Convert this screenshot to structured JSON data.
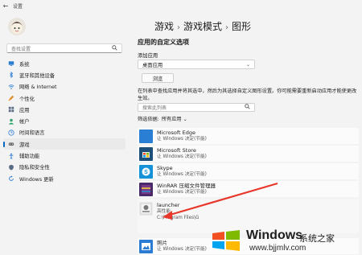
{
  "window": {
    "title": "设置",
    "back_glyph": "←"
  },
  "sidebar": {
    "search_placeholder": "查找设置",
    "items": [
      {
        "label": "系统",
        "icon": "display-icon",
        "color": "#2b7cd3"
      },
      {
        "label": "蓝牙和其他设备",
        "icon": "bluetooth-icon",
        "color": "#2b7cd3"
      },
      {
        "label": "网络 & Internet",
        "icon": "wifi-icon",
        "color": "#2b7cd3"
      },
      {
        "label": "个性化",
        "icon": "brush-icon",
        "color": "#e08a2a"
      },
      {
        "label": "应用",
        "icon": "apps-icon",
        "color": "#5a6b86"
      },
      {
        "label": "帐户",
        "icon": "account-icon",
        "color": "#2fa36b"
      },
      {
        "label": "时间和语言",
        "icon": "clock-globe-icon",
        "color": "#2b7cd3"
      },
      {
        "label": "游戏",
        "icon": "gamepad-icon",
        "color": "#6b6b6b",
        "active": true
      },
      {
        "label": "辅助功能",
        "icon": "accessibility-icon",
        "color": "#2b7cd3"
      },
      {
        "label": "隐私和安全性",
        "icon": "shield-icon",
        "color": "#5a6b86"
      },
      {
        "label": "Windows 更新",
        "icon": "update-icon",
        "color": "#2b7cd3"
      }
    ]
  },
  "breadcrumb": {
    "part1": "游戏",
    "part2": "游戏模式",
    "part3": "图形",
    "sep": "›"
  },
  "main": {
    "section_title": "应用的自定义选项",
    "add_app_label": "添加应用",
    "add_app_select": "桌面应用",
    "browse_button": "浏览",
    "description": "在列表中查找应用并将其选中，然后为其选择自定义图形设置。你可能需要重新启动应用才能使更改生效。",
    "list_search_placeholder": "搜索此列表",
    "filter_label": "筛选依据:",
    "filter_value": "所有应用"
  },
  "apps": [
    {
      "name": "Microsoft Edge",
      "sub": "让 Windows 决定(节能)",
      "icon": "edge-icon"
    },
    {
      "name": "Microsoft Store",
      "sub": "让 Windows 决定(节能)",
      "icon": "store-icon"
    },
    {
      "name": "Skype",
      "sub": "让 Windows 决定(节能)",
      "icon": "skype-icon"
    },
    {
      "name": "WinRAR 压缩文件管理器",
      "sub": "让 Windows 决定(节能)",
      "icon": "winrar-icon"
    },
    {
      "name": "launcher",
      "sub": "高性能",
      "path": "C:\\Program Files\\G",
      "icon": "launcher-icon"
    },
    {
      "name": "照片",
      "sub": "让 Windows 决定(节能)",
      "icon": "photos-icon"
    }
  ],
  "watermark": {
    "brand": "Windows",
    "suffix": "系统之家",
    "url": "www.bjjmlv.com"
  },
  "colors": {
    "accent": "#0067c0",
    "arrow": "#e8372b"
  }
}
